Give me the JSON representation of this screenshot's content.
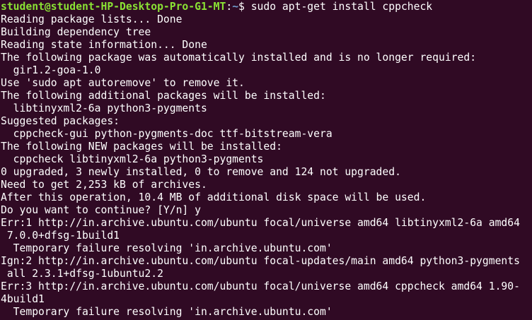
{
  "prompt": {
    "user_host": "student@student-HP-Desktop-Pro-G1-MT",
    "colon": ":",
    "path": "~",
    "symbol": "$ ",
    "command": "sudo apt-get install cppcheck"
  },
  "output": [
    "Reading package lists... Done",
    "Building dependency tree",
    "Reading state information... Done",
    "The following package was automatically installed and is no longer required:",
    "  gir1.2-goa-1.0",
    "Use 'sudo apt autoremove' to remove it.",
    "The following additional packages will be installed:",
    "  libtinyxml2-6a python3-pygments",
    "Suggested packages:",
    "  cppcheck-gui python-pygments-doc ttf-bitstream-vera",
    "The following NEW packages will be installed:",
    "  cppcheck libtinyxml2-6a python3-pygments",
    "0 upgraded, 3 newly installed, 0 to remove and 124 not upgraded.",
    "Need to get 2,253 kB of archives.",
    "After this operation, 10.4 MB of additional disk space will be used.",
    "Do you want to continue? [Y/n] y",
    "Err:1 http://in.archive.ubuntu.com/ubuntu focal/universe amd64 libtinyxml2-6a amd64",
    " 7.0.0+dfsg-1build1",
    "  Temporary failure resolving 'in.archive.ubuntu.com'",
    "Ign:2 http://in.archive.ubuntu.com/ubuntu focal-updates/main amd64 python3-pygments",
    " all 2.3.1+dfsg-1ubuntu2.2",
    "Err:3 http://in.archive.ubuntu.com/ubuntu focal/universe amd64 cppcheck amd64 1.90-",
    "4build1",
    "  Temporary failure resolving 'in.archive.ubuntu.com'"
  ]
}
